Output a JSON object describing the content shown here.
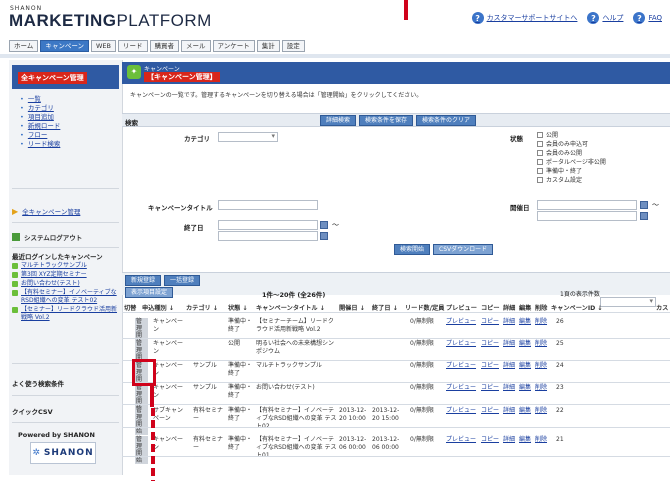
{
  "brand": {
    "small": "SHANON",
    "main_bold": "MARKETING",
    "main_rest": "PLATFORM"
  },
  "toplinks": [
    {
      "label": "カスタマーサポートサイトへ",
      "icon": "question-icon"
    },
    {
      "label": "ヘルプ",
      "icon": "question-icon"
    },
    {
      "label": "FAQ",
      "icon": "question-icon"
    }
  ],
  "global_nav": [
    "ホーム",
    "キャンペーン",
    "WEB",
    "リード",
    "購買者",
    "メール",
    "アンケート",
    "集計",
    "設定"
  ],
  "sidebar": {
    "title": "全キャンペーン管理",
    "links": [
      "一覧",
      "カテゴリ",
      "項目追加",
      "新規ロード",
      "フロー",
      "リード検索"
    ],
    "all_campaign": "全キャンペーン管理",
    "system_logout": "システムログアウト",
    "recent_title": "最近ログインしたキャンペーン",
    "recent": [
      "マルチトラックサンプル",
      "第3回 XYZ定期セミナー",
      "お問い合わせ(テスト)",
      "【有料セミナー】イノベーティブなRSD組織への変革 テスト02",
      "【セミナー】リードクラウド活用新戦略 Vol.2"
    ],
    "search_cond": "よく使う検索条件",
    "quick_csv": "クイックCSV",
    "powered": "Powered by SHANON",
    "logo_text": "SHANON"
  },
  "main": {
    "crumb": "キャンペーン",
    "title": "【キャンペーン管理】",
    "description": "キャンペーンの一覧です。管理するキャンペーンを切り替える場合は「管理開始」をクリックしてください。",
    "search_label": "検索",
    "search_buttons": [
      "詳細検索",
      "検索条件を保存",
      "検索条件のクリア"
    ],
    "category_label": "カテゴリ",
    "status_label": "状態",
    "status_options": [
      "公開",
      "会員のみ申込可",
      "会員のみ公開",
      "ポータルページ非公開",
      "準備中・終了",
      "カスタム設定"
    ],
    "campaign_title_label": "キャンペーンタイトル",
    "start_date_label": "開催日",
    "end_date_label": "終了日",
    "tilde": "〜",
    "action_buttons": [
      "検索開始",
      "CSVダウンロード"
    ],
    "new_buttons": [
      "新規登録",
      "一括登録"
    ],
    "display_setting": "表示項目設定",
    "paging": "1件〜20件 (全26件)",
    "per_page": "1頁の表示件数",
    "columns": [
      "切替",
      "申込種別 ↓",
      "カテゴリ ↓",
      "状態 ↓",
      "キャンペーンタイトル ↓",
      "開催日 ↓",
      "終了日 ↓",
      "リード数/定員",
      "プレビュー",
      "コピー",
      "詳細",
      "編集",
      "削除",
      "キャンペーンID ↓",
      "カス"
    ],
    "rows": [
      {
        "manage": "管理開始",
        "type": "キャンペーン",
        "category": "",
        "status": "準備中・終了",
        "title": "【セミナーチーム】リードクラウド活用新戦略 Vol.2",
        "start": "",
        "end": "",
        "leads": "0/無制限",
        "id": "26"
      },
      {
        "manage": "管理開始",
        "type": "キャンペーン",
        "category": "",
        "status": "公開",
        "title": "明るい社会への未来構想シンポジウム",
        "start": "",
        "end": "",
        "leads": "0/無制限",
        "id": "25"
      },
      {
        "manage": "管理開始",
        "type": "キャンペーン",
        "category": "サンプル",
        "status": "準備中・終了",
        "title": "マルチトラックサンプル",
        "start": "",
        "end": "",
        "leads": "0/無制限",
        "id": "24"
      },
      {
        "manage": "管理開始",
        "type": "キャンペーン",
        "category": "サンプル",
        "status": "準備中・終了",
        "title": "お問い合わせ(テスト)",
        "start": "",
        "end": "",
        "leads": "0/無制限",
        "id": "23"
      },
      {
        "manage": "管理開始",
        "type": "サブキャンペーン",
        "category": "有料セミナー",
        "status": "準備中・終了",
        "title": "【有料セミナー】イノベーティブなRSD組織への変革 テスト02",
        "start": "2013-12-20 10:00",
        "end": "2013-12-20 15:00",
        "leads": "0/無制限",
        "id": "22"
      },
      {
        "manage": "管理開始",
        "type": "キャンペーン",
        "category": "有料セミナー",
        "status": "準備中・終了",
        "title": "【有料セミナー】イノベーティブなRSD組織への変革 テスト01",
        "start": "2013-12-06 00:00",
        "end": "2013-12-06 00:00",
        "leads": "0/無制限",
        "id": "21"
      }
    ],
    "row_actions": [
      "プレビュー",
      "コピー",
      "詳細",
      "編集",
      "削除"
    ]
  },
  "colors": {
    "accent": "#2f5aa3",
    "highlight": "#d8261b",
    "annotation": "#d0021b"
  }
}
